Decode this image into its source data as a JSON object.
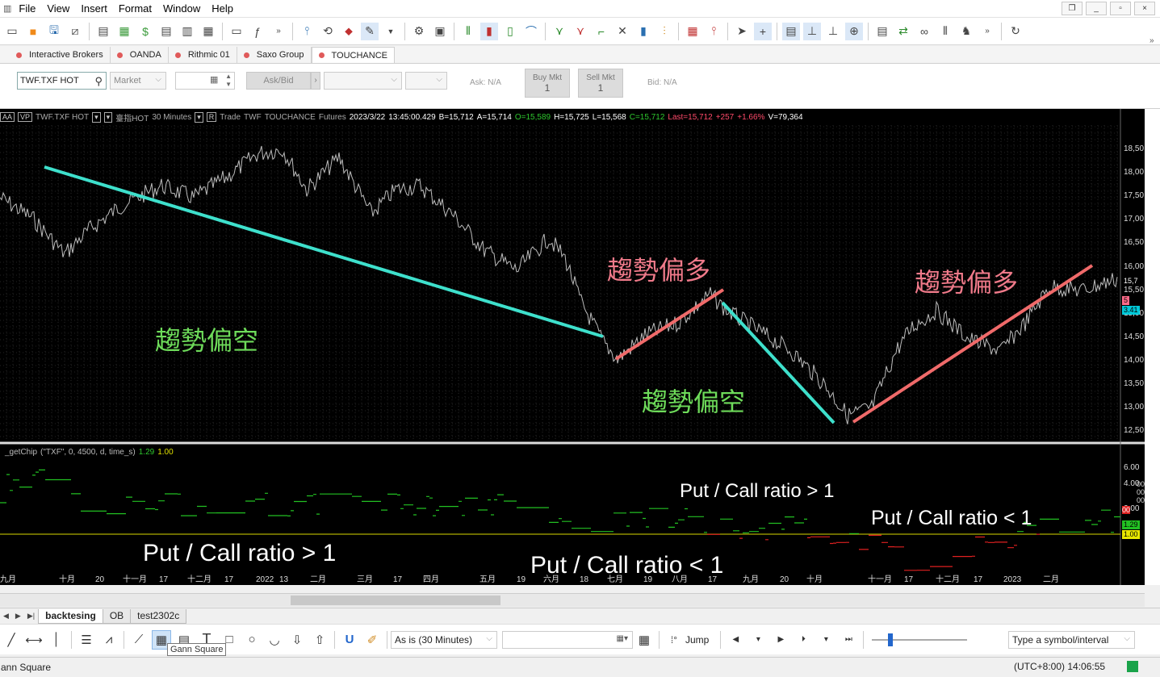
{
  "menu": [
    "File",
    "View",
    "Insert",
    "Format",
    "Window",
    "Help"
  ],
  "brokers": [
    {
      "label": "Interactive Brokers",
      "active": false
    },
    {
      "label": "OANDA",
      "active": false
    },
    {
      "label": "Rithmic 01",
      "active": false
    },
    {
      "label": "Saxo Group",
      "active": false
    },
    {
      "label": "TOUCHANCE",
      "active": true
    }
  ],
  "order": {
    "symbol": "TWF.TXF HOT",
    "order_type": "Market",
    "ask_bid": "Ask/Bid",
    "ask": "Ask: N/A",
    "bid": "Bid: N/A",
    "buy_label": "Buy Mkt",
    "buy_qty": "1",
    "sell_label": "Sell Mkt",
    "sell_qty": "1"
  },
  "info": {
    "aa": "AA",
    "vp": "VP",
    "symbol": "TWF.TXF HOT",
    "name": "臺指HOT",
    "interval": "30 Minutes",
    "r": "R",
    "trade": "Trade",
    "exch": "TWF",
    "source": "TOUCHANCE",
    "type": "Futures",
    "datetime": "2023/3/22",
    "time": "13:45:00.429",
    "b": "B=15,712",
    "a": "A=15,714",
    "o": "O=15,589",
    "h": "H=15,725",
    "l": "L=15,568",
    "c": "C=15,712",
    "last": "Last=15,712",
    "chg": "+257",
    "pct": "+1.66%",
    "v": "V=79,364"
  },
  "indicator": {
    "name": "_getChip",
    "params": "(\"TXF\",  0,  4500,  d,  time_s)",
    "v1": "1.29",
    "v2": "1.00"
  },
  "price_axis": [
    "18,50",
    "18,00",
    "17,50",
    "17,00",
    "16,50",
    "16,00",
    "15,50",
    "15,00",
    "14,50",
    "14,00",
    "13,50",
    "13,00",
    "12,50"
  ],
  "price_tags": {
    "last": "15,7",
    "red": "5",
    "cyan": "3.41"
  },
  "ind_axis": [
    "6.00",
    "4.00",
    "2.00"
  ],
  "ind_right_extra": [
    "00",
    "00",
    "00",
    "00"
  ],
  "ind_tags": {
    "green": "1.29",
    "yellow": "1.00"
  },
  "date_axis": [
    "九月",
    "十月",
    "20",
    "十一月",
    "17",
    "十二月",
    "17",
    "2022",
    "13",
    "二月",
    "三月",
    "17",
    "四月",
    "五月",
    "19",
    "六月",
    "18",
    "七月",
    "19",
    "八月",
    "17",
    "九月",
    "20",
    "十月",
    "十一月",
    "17",
    "十二月",
    "17",
    "2023",
    "二月"
  ],
  "annotations": {
    "bear1": "趨勢偏空",
    "bull1": "趨勢偏多",
    "bear2": "趨勢偏空",
    "bull2": "趨勢偏多",
    "pc_gt1_left": "Put / Call ratio > 1",
    "pc_lt1_mid": "Put / Call ratio < 1",
    "pc_gt1_top": "Put / Call ratio > 1",
    "pc_lt1_right": "Put / Call ratio < 1"
  },
  "colors": {
    "cyan": "#3ee0cc",
    "red": "#f06a6a",
    "green_text": "#6edc5a",
    "pink_text": "#f07a8a",
    "white": "#ffffff",
    "ind_green": "#22c022",
    "ind_red": "#e02020",
    "yellow": "#d8d800"
  },
  "sheets": [
    {
      "label": "backtesing",
      "active": true
    },
    {
      "label": "OB",
      "active": false
    },
    {
      "label": "test2302c",
      "active": false
    }
  ],
  "drawbar": {
    "interval": "As is (30 Minutes)",
    "jump": "Jump",
    "symbol_placeholder": "Type a symbol/interval",
    "tooltip": "Gann Square"
  },
  "status": {
    "left": "ann Square",
    "clock": "(UTC+8:00) 14:06:55"
  }
}
